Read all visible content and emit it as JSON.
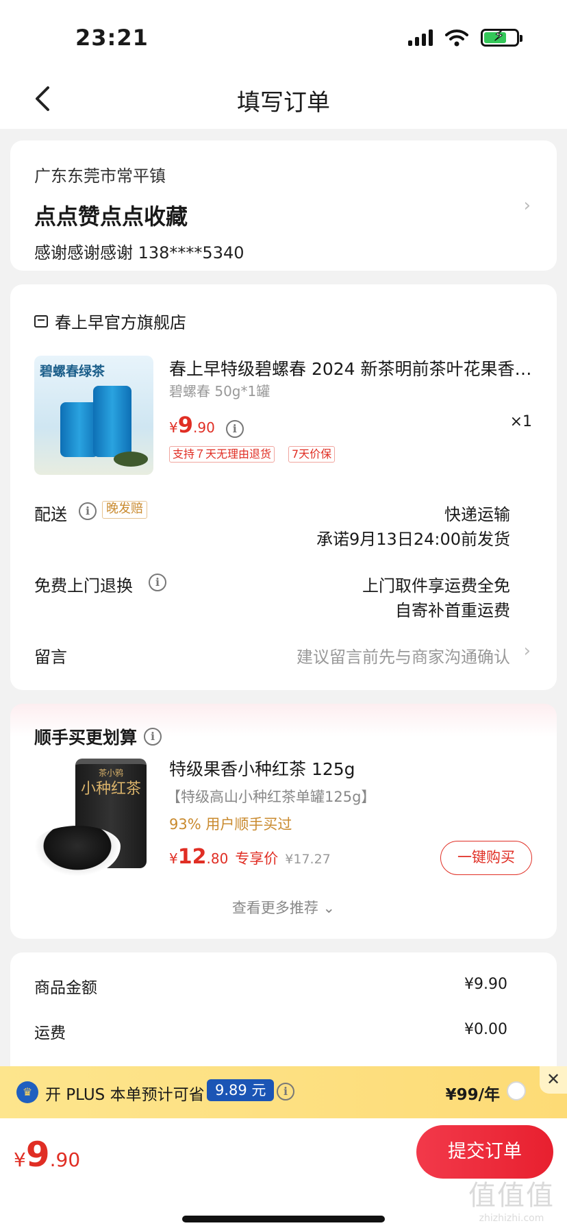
{
  "status_bar": {
    "time": "23:21"
  },
  "nav": {
    "title": "填写订单"
  },
  "address": {
    "region": "广东东莞市常平镇",
    "detail": "点点赞点点收藏",
    "contact": "感谢感谢感谢  138****5340"
  },
  "store": {
    "name": "春上早官方旗舰店",
    "product": {
      "image_text": "碧螺春绿茶",
      "title": "春上早特级碧螺春 2024 新茶明前茶叶花果香…",
      "spec": "碧螺春 50g*1罐",
      "price_currency": "¥",
      "price_int": "9",
      "price_dec": ".90",
      "quantity": "×1",
      "tags": [
        "支持７天无理由退货",
        "7天价保"
      ]
    },
    "delivery": {
      "label": "配送",
      "late_tag": "晚发赔",
      "method": "快递运输",
      "promise": "承诺9月13日24:00前发货"
    },
    "return": {
      "label": "免费上门退换",
      "line1": "上门取件享运费全免",
      "line2": "自寄补首重运费"
    },
    "message": {
      "label": "留言",
      "placeholder": "建议留言前先与商家沟通确认"
    }
  },
  "upsell": {
    "title": "顺手买更划算",
    "product": {
      "image_text_brand": "茶小鸦",
      "image_text_name": "小种红茶",
      "name": "特级果香小种红茶 125g",
      "spec": "【特级高山小种红茶单罐125g】",
      "bought": "93% 用户顺手买过",
      "price_currency": "¥",
      "price_int": "12",
      "price_dec": ".80",
      "price_label": "专享价",
      "original_price": "¥17.27",
      "buy_label": "一键购买"
    },
    "more_label": "查看更多推荐"
  },
  "summary": {
    "goods_label": "商品金额",
    "goods_value": "¥9.90",
    "shipping_label": "运费",
    "shipping_value": "¥0.00"
  },
  "plus": {
    "text": "开 PLUS 本单预计可省",
    "save_amount": "9.89 元",
    "price": "¥99/年"
  },
  "bottom": {
    "total_currency": "¥",
    "total_int": "9",
    "total_dec": ".90",
    "submit_label": "提交订单",
    "watermark_main": "值值值",
    "watermark_sub": "zhizhizhi.com"
  },
  "colors": {
    "accent": "#e02e24",
    "plus_blue": "#1b55b5",
    "plus_bg": "#fddb76"
  }
}
